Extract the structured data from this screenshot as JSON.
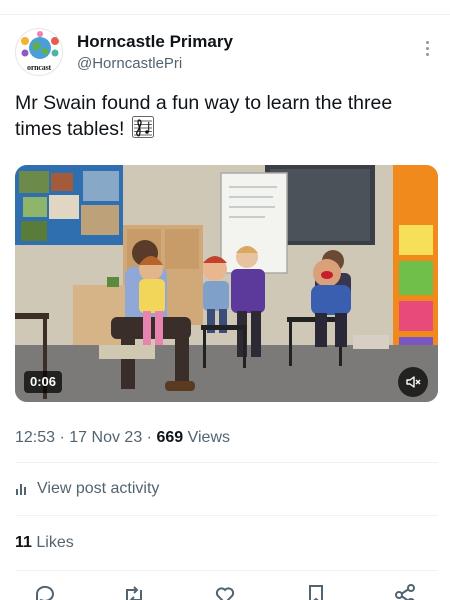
{
  "author": {
    "display_name": "Horncastle Primary",
    "handle": "@HorncastlePri",
    "avatar_text": "orncast"
  },
  "post": {
    "text": "Mr Swain found a fun way to learn the three times tables!",
    "emoji_icon": "musical-score-icon"
  },
  "video": {
    "duration": "0:06",
    "mute_icon": "speaker-muted-icon"
  },
  "meta": {
    "time": "12:53",
    "separator_1": "·",
    "date": "17 Nov 23",
    "separator_2": "·",
    "views_count": "669",
    "views_label": "Views"
  },
  "activity": {
    "label": "View post activity",
    "icon": "bar-chart-icon"
  },
  "likes": {
    "count": "11",
    "label": "Likes"
  },
  "action_bar": {
    "icons": [
      "reply-icon",
      "repost-icon",
      "like-icon",
      "bookmark-icon",
      "share-icon"
    ]
  },
  "colors": {
    "text_primary": "#0f1419",
    "text_secondary": "#536471",
    "divider": "#eff3f4"
  }
}
